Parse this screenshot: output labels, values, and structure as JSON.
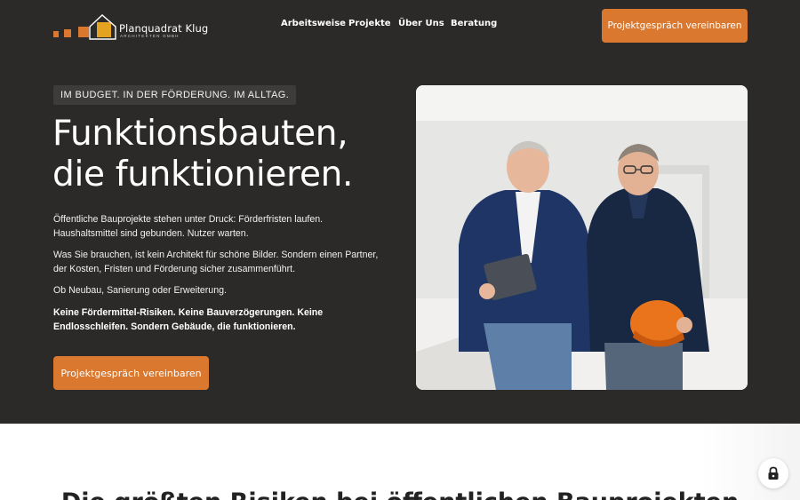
{
  "header": {
    "logo": {
      "name": "Planquadrat Klug",
      "subtitle": "ARCHITEKTEN GMBH",
      "icon": "house-squares-logo"
    },
    "nav": [
      {
        "label": "Arbeitsweise"
      },
      {
        "label": "Projekte"
      },
      {
        "label": "Über Uns"
      },
      {
        "label": "Beratung"
      }
    ],
    "cta_label": "Projektgespräch vereinbaren"
  },
  "hero": {
    "badge": "IM BUDGET. IN DER FÖRDERUNG. IM ALLTAG.",
    "headline": "Funktionsbauten, die funktionieren.",
    "paragraphs": [
      "Öffentliche Bauprojekte stehen unter Druck: Förderfristen laufen. Haushaltsmittel sind gebunden. Nutzer warten.",
      "Was Sie brauchen, ist kein Architekt für schöne Bilder. Sondern einen Partner, der Kosten, Fristen und Förderung sicher zusammenführt.",
      "Ob Neubau, Sanierung oder Erweiterung.",
      "Keine Fördermittel-Risiken. Keine Bauverzögerungen. Keine Endlosschleifen. Sondern Gebäude, die funktionieren."
    ],
    "cta_label": "Projektgespräch vereinbaren",
    "photo": "two-architects-photo"
  },
  "next_section": {
    "title": "Die größten Risiken bei öffentlichen Bauprojekten"
  },
  "privacy_button": {
    "icon": "lock-icon"
  },
  "colors": {
    "background": "#2b2a29",
    "accent": "#d9782e",
    "badge_bg": "#3d3c3b"
  }
}
